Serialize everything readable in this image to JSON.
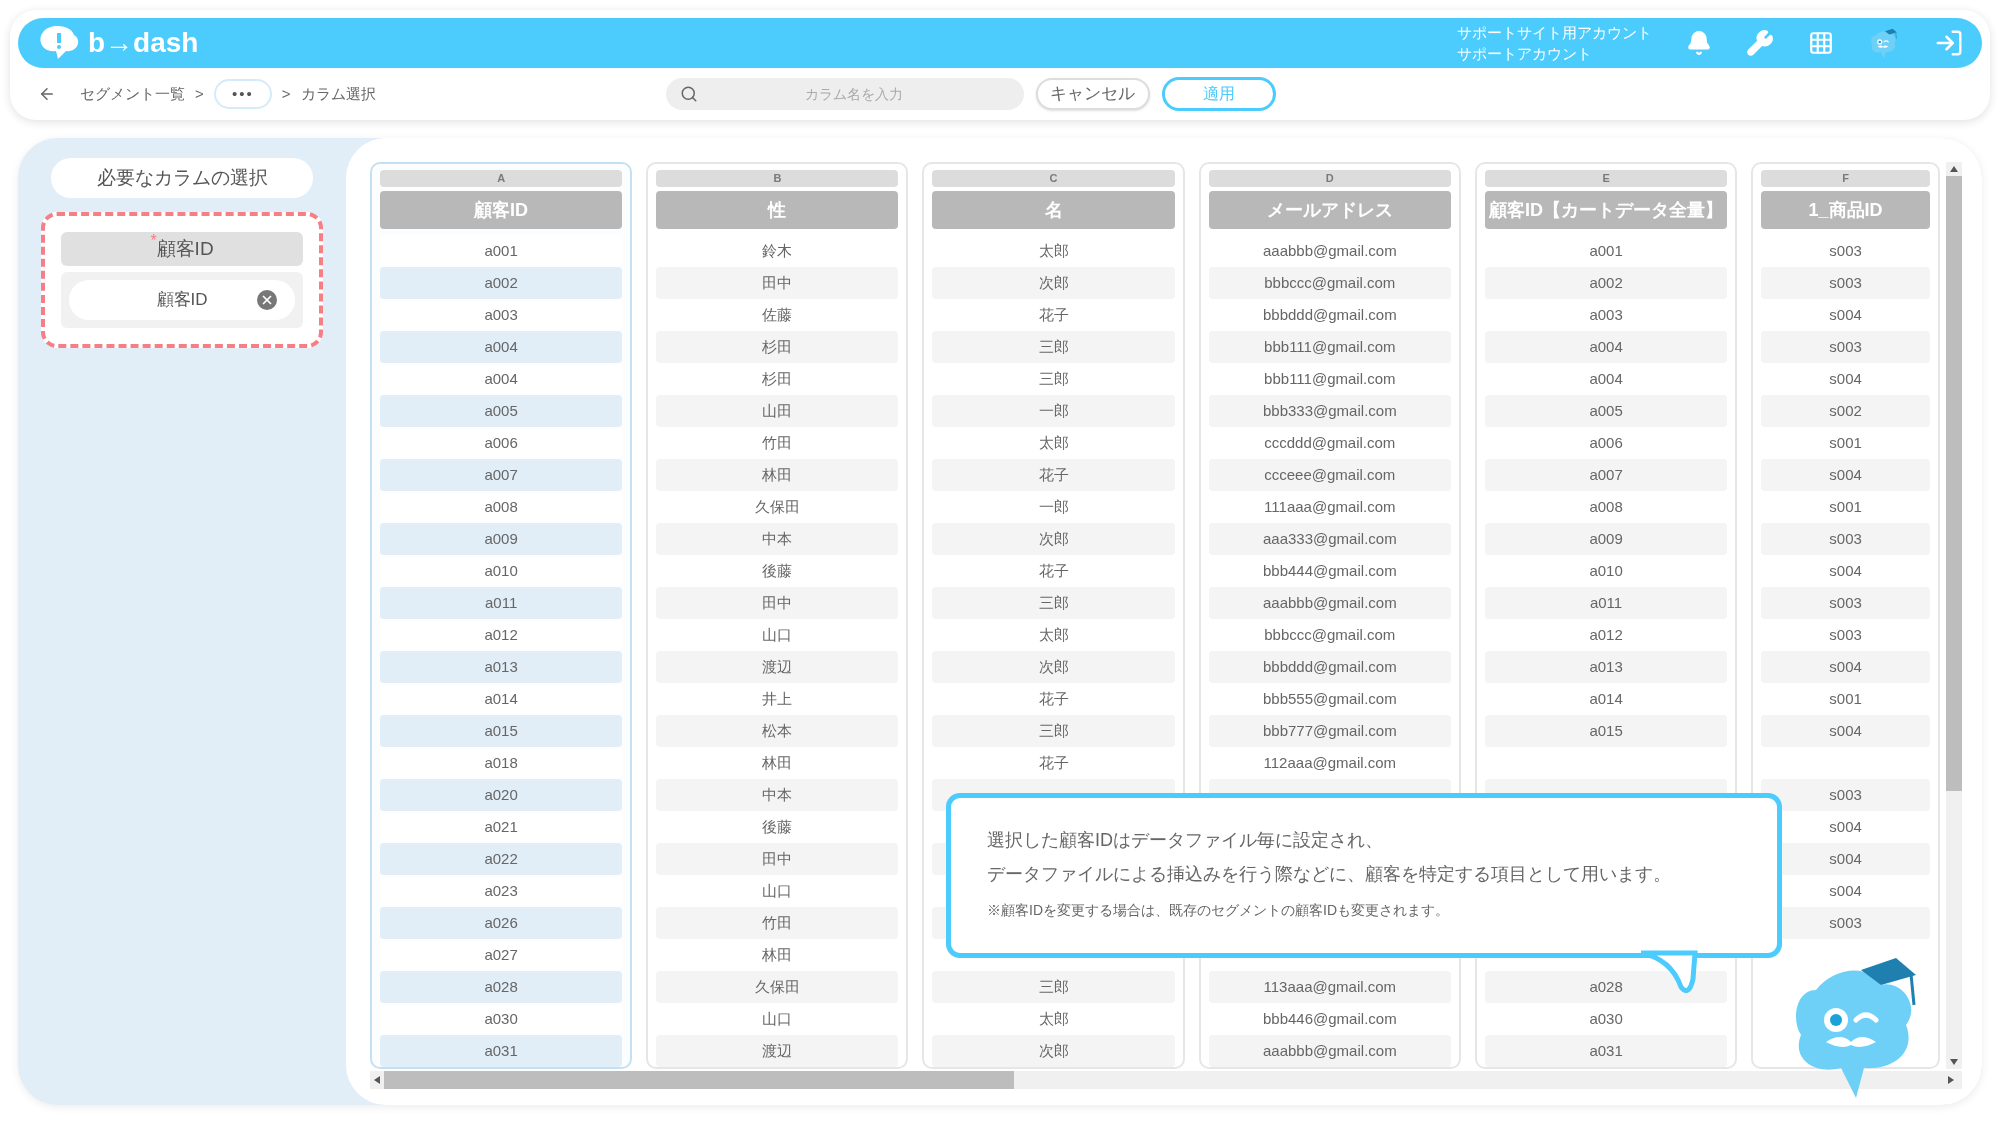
{
  "header": {
    "logo": "b→dash",
    "account_lines": [
      "サポートサイト用アカウント",
      "サポートアカウント"
    ]
  },
  "breadcrumb": [
    {
      "kind": "link",
      "label": "セグメント一覧"
    },
    {
      "kind": "separator",
      "label": ">"
    },
    {
      "kind": "ellipsis",
      "label": "•••"
    },
    {
      "kind": "separator",
      "label": ">"
    },
    {
      "kind": "current",
      "label": "カラム選択"
    }
  ],
  "search": {
    "placeholder": "カラム名を入力"
  },
  "buttons": [
    {
      "kind": "secondary",
      "label": "キャンセル"
    },
    {
      "kind": "primary",
      "label": "適用"
    }
  ],
  "sidebar": {
    "title": "必要なカラムの選択",
    "field": {
      "label": "顧客ID",
      "required": true,
      "required_mark": "*",
      "chip": "顧客ID"
    }
  },
  "table": {
    "columns": [
      {
        "letter": "A",
        "header": "顧客ID",
        "selected": true
      },
      {
        "letter": "B",
        "header": "性",
        "selected": false
      },
      {
        "letter": "C",
        "header": "名",
        "selected": false
      },
      {
        "letter": "D",
        "header": "メールアドレス",
        "selected": false
      },
      {
        "letter": "E",
        "header": "顧客ID【カートデータ全量】",
        "selected": false
      },
      {
        "letter": "F",
        "header": "1_商品ID",
        "selected": false
      }
    ],
    "rows": [
      [
        "a001",
        "鈴木",
        "太郎",
        "aaabbb@gmail.com",
        "a001",
        "s003"
      ],
      [
        "a002",
        "田中",
        "次郎",
        "bbbccc@gmail.com",
        "a002",
        "s003"
      ],
      [
        "a003",
        "佐藤",
        "花子",
        "bbbddd@gmail.com",
        "a003",
        "s004"
      ],
      [
        "a004",
        "杉田",
        "三郎",
        "bbb111@gmail.com",
        "a004",
        "s003"
      ],
      [
        "a004",
        "杉田",
        "三郎",
        "bbb111@gmail.com",
        "a004",
        "s004"
      ],
      [
        "a005",
        "山田",
        "一郎",
        "bbb333@gmail.com",
        "a005",
        "s002"
      ],
      [
        "a006",
        "竹田",
        "太郎",
        "cccddd@gmail.com",
        "a006",
        "s001"
      ],
      [
        "a007",
        "林田",
        "花子",
        "ccceee@gmail.com",
        "a007",
        "s004"
      ],
      [
        "a008",
        "久保田",
        "一郎",
        "111aaa@gmail.com",
        "a008",
        "s001"
      ],
      [
        "a009",
        "中本",
        "次郎",
        "aaa333@gmail.com",
        "a009",
        "s003"
      ],
      [
        "a010",
        "後藤",
        "花子",
        "bbb444@gmail.com",
        "a010",
        "s004"
      ],
      [
        "a011",
        "田中",
        "三郎",
        "aaabbb@gmail.com",
        "a011",
        "s003"
      ],
      [
        "a012",
        "山口",
        "太郎",
        "bbbccc@gmail.com",
        "a012",
        "s003"
      ],
      [
        "a013",
        "渡辺",
        "次郎",
        "bbbddd@gmail.com",
        "a013",
        "s004"
      ],
      [
        "a014",
        "井上",
        "花子",
        "bbb555@gmail.com",
        "a014",
        "s001"
      ],
      [
        "a015",
        "松本",
        "三郎",
        "bbb777@gmail.com",
        "a015",
        "s004"
      ],
      [
        "a018",
        "林田",
        "花子",
        "112aaa@gmail.com",
        null,
        null
      ],
      [
        "a020",
        "中本",
        null,
        null,
        null,
        "s003"
      ],
      [
        "a021",
        "後藤",
        null,
        null,
        null,
        "s004"
      ],
      [
        "a022",
        "田中",
        null,
        null,
        null,
        "s004"
      ],
      [
        "a023",
        "山口",
        null,
        null,
        null,
        "s004"
      ],
      [
        "a026",
        "竹田",
        null,
        null,
        null,
        "s003"
      ],
      [
        "a027",
        "林田",
        null,
        null,
        null,
        null
      ],
      [
        "a028",
        "久保田",
        "三郎",
        "113aaa@gmail.com",
        "a028",
        null
      ],
      [
        "a030",
        "山口",
        "太郎",
        "bbb446@gmail.com",
        "a030",
        null
      ],
      [
        "a031",
        "渡辺",
        "次郎",
        "aaabbb@gmail.com",
        "a031",
        null
      ]
    ]
  },
  "tooltip": {
    "lines": [
      "選択した顧客IDはデータファイル毎に設定され、",
      "データファイルによる挿込みを行う際などに、顧客を特定する項目として用います。"
    ],
    "note": "※顧客IDを変更する場合は、既存のセグメントの顧客IDも変更されます。"
  }
}
